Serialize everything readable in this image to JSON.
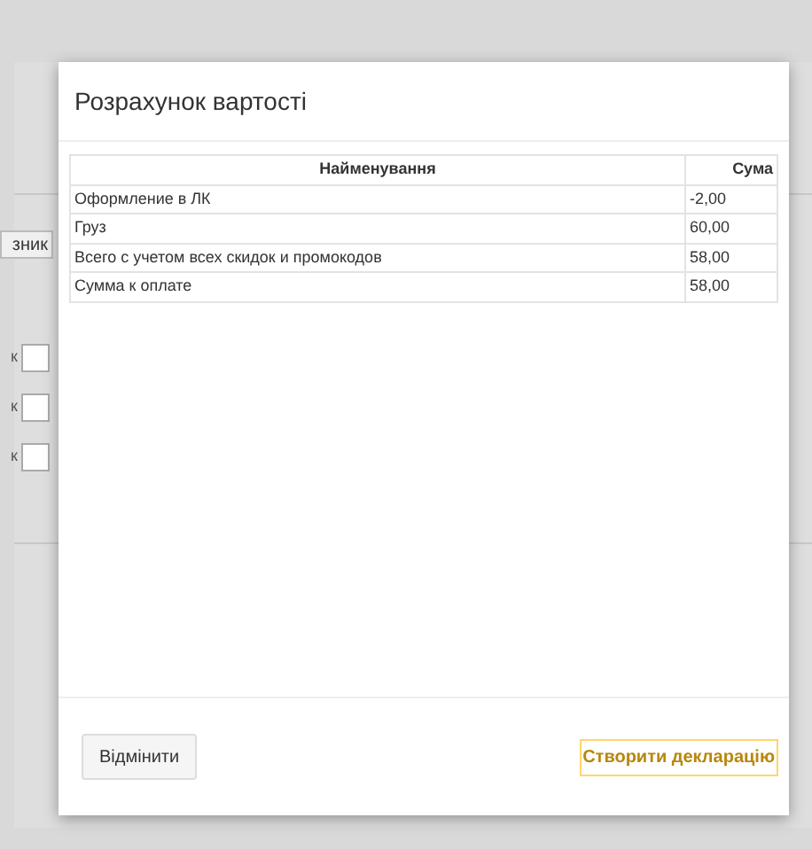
{
  "background": {
    "button_label": "зник",
    "field_labels": [
      "к",
      "к",
      "к"
    ]
  },
  "dialog": {
    "title": "Розрахунок вартості",
    "table": {
      "columns": [
        "Найменування",
        "Сума"
      ],
      "rows": [
        [
          "Оформление в ЛК",
          "-2,00"
        ],
        [
          "Груз",
          "60,00"
        ],
        [
          "Всего с учетом всех скидок и промокодов",
          "58,00"
        ],
        [
          "Сумма к оплате",
          "58,00"
        ]
      ]
    },
    "buttons": [
      {
        "label": "Відмінити",
        "kind": "secondary"
      },
      {
        "label": "Створити декларацію",
        "kind": "primary"
      }
    ]
  }
}
